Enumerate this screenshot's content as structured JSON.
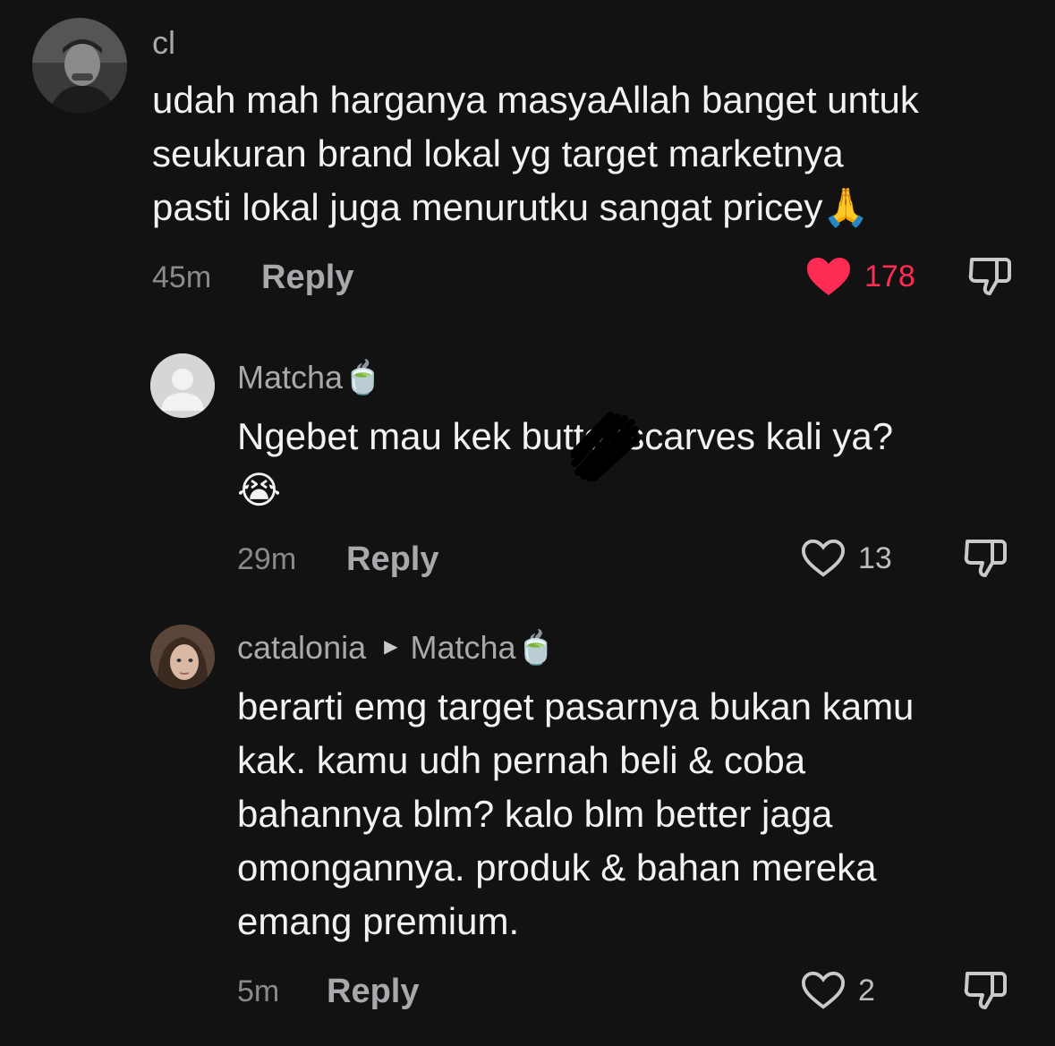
{
  "comments": [
    {
      "username": "cl",
      "text": "udah mah harganya masyaAllah banget untuk\nseukuran brand lokal yg target marketnya\npasti lokal juga menurutku sangat pricey🙏",
      "time": "45m",
      "reply_label": "Reply",
      "likes": "178",
      "liked": true,
      "avatar_icon": "person-photo"
    },
    {
      "username": "Matcha🍵",
      "text": "Ngebet mau kek buttonscarves kali ya?\n😭",
      "time": "29m",
      "reply_label": "Reply",
      "likes": "13",
      "liked": false,
      "avatar_icon": "default-avatar"
    },
    {
      "username": "catalonia",
      "reply_to": "Matcha🍵",
      "text": "berarti emg target pasarnya bukan kamu\nkak. kamu udh pernah beli & coba\nbahannya blm? kalo blm better jaga\nomongannya. produk & bahan mereka\nemang premium.",
      "time": "5m",
      "reply_label": "Reply",
      "likes": "2",
      "liked": false,
      "avatar_icon": "person-photo"
    }
  ],
  "colors": {
    "background": "#121212",
    "like_active": "#fe2c55",
    "secondary_text": "#a9a9ad"
  }
}
